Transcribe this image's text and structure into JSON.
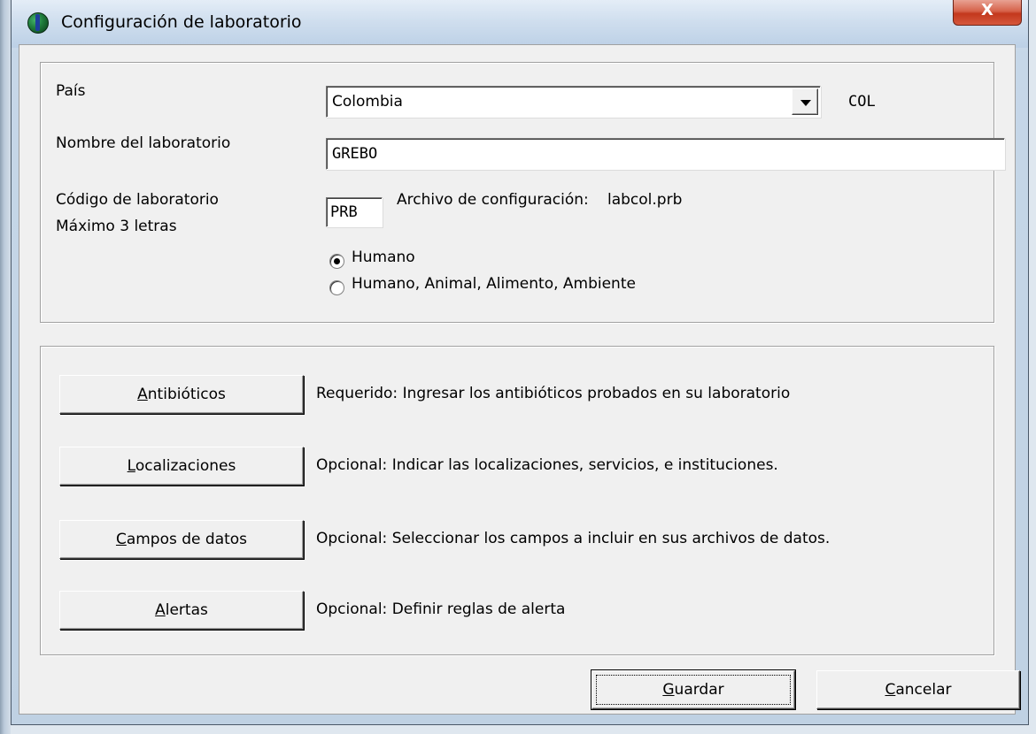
{
  "window": {
    "title": "Configuración de laboratorio",
    "close_label": "X"
  },
  "config": {
    "pais_label": "País",
    "pais_value": "Colombia",
    "pais_code": "COL",
    "nombre_label": "Nombre del laboratorio",
    "nombre_value": "GREBO",
    "codigo_label": "Código de laboratorio",
    "codigo_hint": "Máximo 3 letras",
    "codigo_value": "PRB",
    "archivo_label": "Archivo de configuración:",
    "archivo_value": "labcol.prb",
    "radio_options": [
      {
        "label": "Humano",
        "checked": true
      },
      {
        "label": "Humano, Animal, Alimento, Ambiente",
        "checked": false
      }
    ]
  },
  "sections": [
    {
      "mnemonic": "A",
      "rest": "ntibióticos",
      "description": "Requerido:  Ingresar los antibióticos probados en su laboratorio"
    },
    {
      "mnemonic": "L",
      "rest": "ocalizaciones",
      "description": "Opcional:  Indicar las localizaciones, servicios, e instituciones."
    },
    {
      "mnemonic": "C",
      "rest": "ampos de datos",
      "description": "Opcional:  Seleccionar los campos a incluir en sus archivos de datos."
    },
    {
      "mnemonic": "A",
      "rest": "lertas",
      "description": "Opcional:  Definir reglas de alerta"
    }
  ],
  "footer": {
    "save_mnemonic": "G",
    "save_rest": "uardar",
    "cancel_mnemonic": "C",
    "cancel_rest": "ancelar"
  }
}
